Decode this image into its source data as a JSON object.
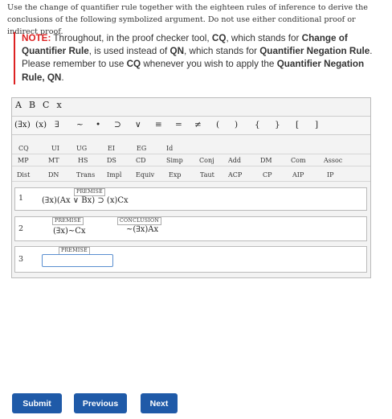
{
  "instructions": "Use the change of quantifier rule together with the eighteen rules of inference to derive the conclusions of the following symbolized argument. Do not use either conditional proof or indirect proof.",
  "note": {
    "label": "NOTE:",
    "text_1": " Throughout, in the proof checker tool, ",
    "cq": "CQ",
    "text_2": ", which stands for ",
    "change_q": "Change of Quantifier Rule",
    "text_3": ", is used instead of ",
    "qn": "QN",
    "text_4": ", which stands for ",
    "quant_neg": "Quantifier Negation Rule",
    "text_5": ". Please remember to use ",
    "cq2": "CQ",
    "text_6": " whenever you wish to apply the ",
    "qnr": "Quantifier Negation Rule, QN",
    "text_7": "."
  },
  "variables": [
    "A",
    "B",
    "C",
    "x"
  ],
  "symbols": [
    "(∃x)",
    "(x)",
    "∃",
    "~",
    "•",
    "⊃",
    "∨",
    "≡",
    "=",
    "≠",
    "(",
    ")",
    "{",
    "}",
    "[",
    "]"
  ],
  "rules_top": [
    "CQ",
    "UI",
    "UG",
    "EI",
    "EG",
    "Id"
  ],
  "rules_row1": [
    "MP",
    "MT",
    "HS",
    "DS",
    "CD",
    "Simp",
    "Conj",
    "Add",
    "DM",
    "Com",
    "Assoc"
  ],
  "rules_row2": [
    "Dist",
    "DN",
    "Trans",
    "Impl",
    "Equiv",
    "Exp",
    "Taut",
    "ACP",
    "CP",
    "AIP",
    "IP"
  ],
  "lines": [
    {
      "num": "1",
      "tag": "PREMISE",
      "formula": "(∃x)(Ax ∨ Bx) ⊃ (x)Cx"
    },
    {
      "num": "2",
      "tag": "PREMISE",
      "formula": "(∃x)~Cx",
      "tag2": "CONCLUSION",
      "formula2": "~(∃x)Ax"
    },
    {
      "num": "3",
      "tag": "PREMISE",
      "formula": ""
    }
  ],
  "buttons": {
    "submit": "Submit",
    "previous": "Previous",
    "next": "Next"
  }
}
